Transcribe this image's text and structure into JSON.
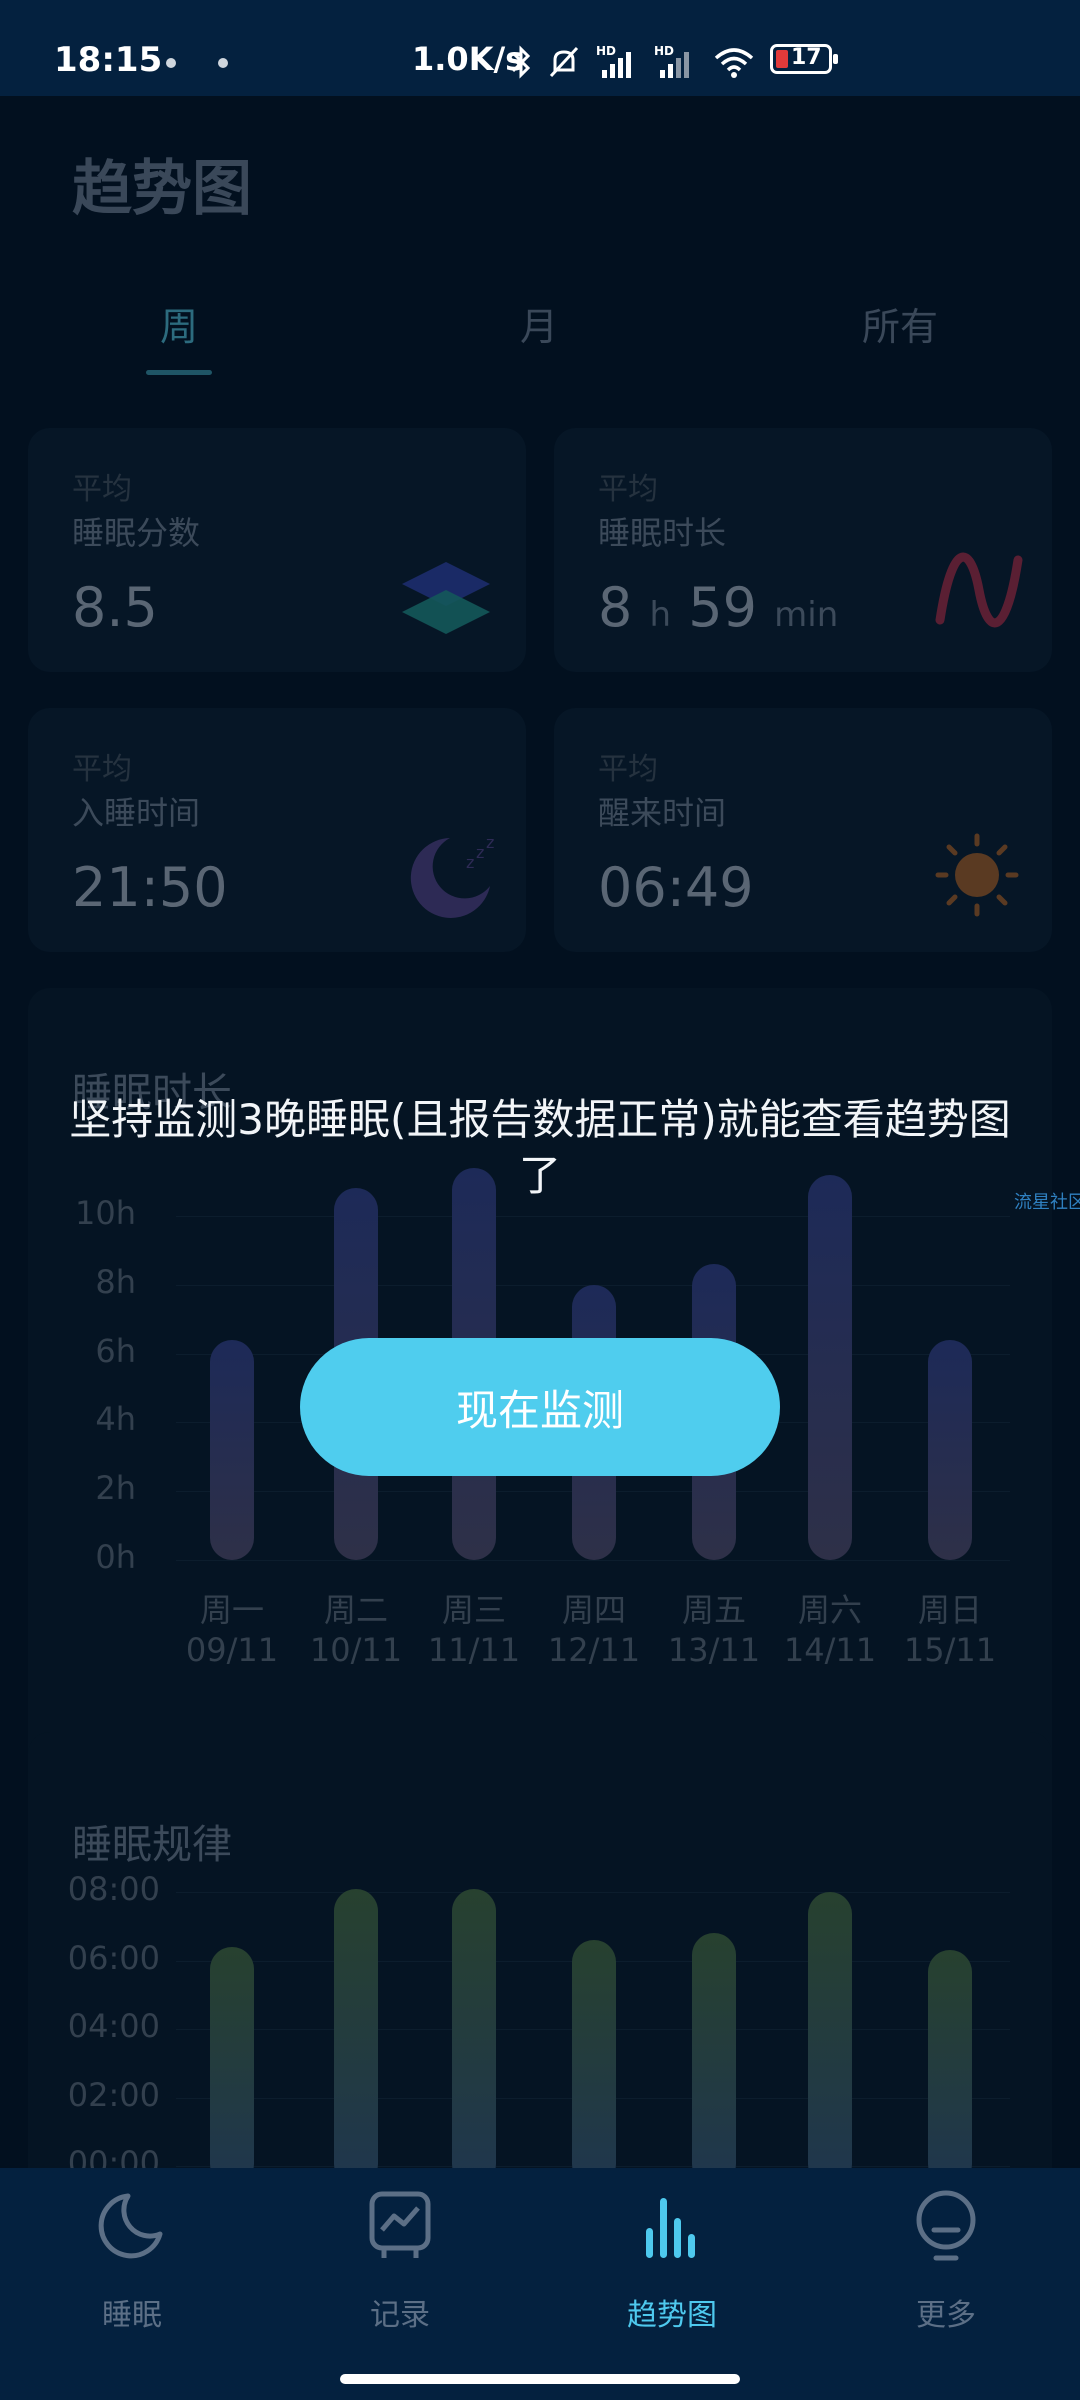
{
  "status_bar": {
    "time": "18:15",
    "network_speed": "1.0K/s",
    "battery_level": "17",
    "signal_labels": [
      "HD",
      "HD"
    ]
  },
  "page": {
    "title": "趋势图",
    "tabs": [
      {
        "label": "周",
        "active": true
      },
      {
        "label": "月",
        "active": false
      },
      {
        "label": "所有",
        "active": false
      }
    ]
  },
  "stats": {
    "score": {
      "prefix": "平均",
      "label": "睡眠分数",
      "value": "8.5"
    },
    "duration": {
      "prefix": "平均",
      "label": "睡眠时长",
      "hours": "8",
      "hours_unit": "h",
      "minutes": "59",
      "minutes_unit": "min"
    },
    "sleep_time": {
      "prefix": "平均",
      "label": "入睡时间",
      "value": "21:50"
    },
    "wake_time": {
      "prefix": "平均",
      "label": "醒来时间",
      "value": "06:49"
    }
  },
  "chart_data": [
    {
      "type": "bar",
      "title": "睡眠时长",
      "y_ticks": [
        "10h",
        "8h",
        "6h",
        "4h",
        "2h",
        "0h"
      ],
      "ylim": [
        0,
        10
      ],
      "categories": [
        "周一",
        "周二",
        "周三",
        "周四",
        "周五",
        "周六",
        "周日"
      ],
      "dates": [
        "09/11",
        "10/11",
        "11/11",
        "12/11",
        "13/11",
        "14/11",
        "15/11"
      ],
      "values": [
        6.4,
        10.8,
        11.4,
        8.0,
        8.6,
        11.2,
        6.4
      ]
    },
    {
      "type": "bar",
      "title": "睡眠规律",
      "y_ticks": [
        "08:00",
        "06:00",
        "04:00",
        "02:00",
        "00:00"
      ],
      "ylim": [
        0,
        8
      ],
      "values": [
        6.4,
        8.1,
        8.1,
        6.6,
        6.8,
        8.0,
        6.3
      ]
    }
  ],
  "overlay": {
    "message": "坚持监测3晚睡眠(且报告数据正常)就能查看趋势图了",
    "button_label": "现在监测",
    "side_mark": "流星社区"
  },
  "bottom_nav": [
    {
      "label": "睡眠",
      "icon": "moon-icon",
      "active": false
    },
    {
      "label": "记录",
      "icon": "record-icon",
      "active": false
    },
    {
      "label": "趋势图",
      "icon": "trend-bars-icon",
      "active": true
    },
    {
      "label": "更多",
      "icon": "bulb-icon",
      "active": false
    }
  ],
  "colors": {
    "accent": "#4fcdee",
    "nav_background": "#04213f",
    "page_background": "#02101f"
  }
}
